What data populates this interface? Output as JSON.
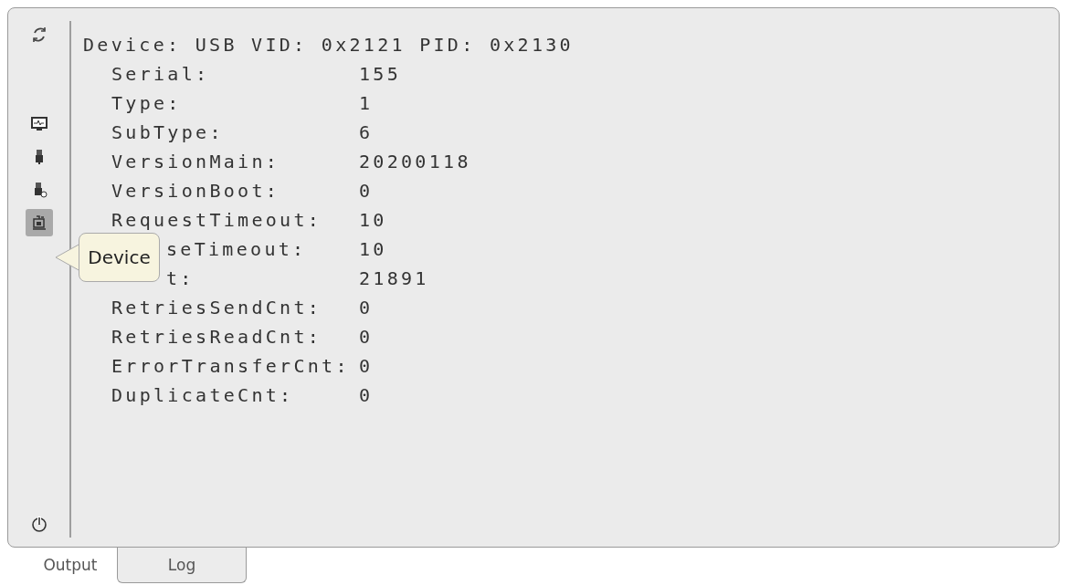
{
  "sidebar": {
    "top": [
      {
        "kind": "refresh",
        "selected": false
      }
    ],
    "items": [
      {
        "kind": "monitor",
        "selected": false
      },
      {
        "kind": "usb",
        "selected": false
      },
      {
        "kind": "usb-status",
        "selected": false
      },
      {
        "kind": "device",
        "selected": true
      }
    ],
    "bottom": [
      {
        "kind": "power",
        "selected": false
      }
    ]
  },
  "tooltip": {
    "text": "Device"
  },
  "output": {
    "heading": "Device: USB VID: 0x2121 PID: 0x2130",
    "rows": [
      {
        "label": "Serial:",
        "value": "155",
        "covered": false
      },
      {
        "label": "Type:",
        "value": "1",
        "covered": false
      },
      {
        "label": "SubType:",
        "value": "6",
        "covered": false
      },
      {
        "label": "VersionMain:",
        "value": "20200118",
        "covered": false
      },
      {
        "label": "VersionBoot:",
        "value": "0",
        "covered": false
      },
      {
        "label": "RequestTimeout:",
        "value": "10",
        "covered": false
      },
      {
        "label": "seTimeout:",
        "value": "10",
        "covered": true
      },
      {
        "label": "t:",
        "value": "21891",
        "covered": true
      },
      {
        "label": "RetriesSendCnt:",
        "value": "0",
        "covered": false
      },
      {
        "label": "RetriesReadCnt:",
        "value": "0",
        "covered": false
      },
      {
        "label": "ErrorTransferCnt:",
        "value": "0",
        "covered": false
      },
      {
        "label": "DuplicateCnt:",
        "value": "0",
        "covered": false
      }
    ]
  },
  "tabs": [
    {
      "label": "Output",
      "selected": true
    },
    {
      "label": "Log",
      "selected": false
    }
  ]
}
